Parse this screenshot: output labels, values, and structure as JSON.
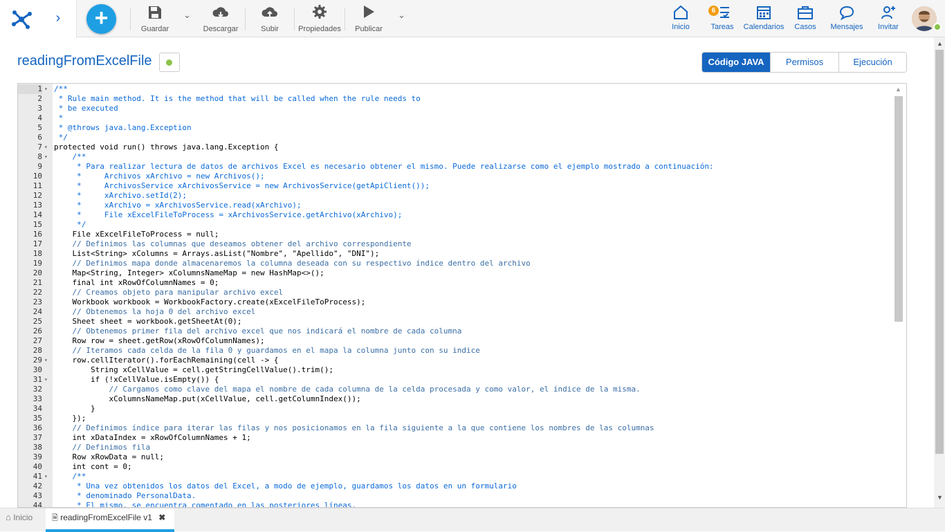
{
  "toolbar": {
    "save_label": "Guardar",
    "download_label": "Descargar",
    "upload_label": "Subir",
    "properties_label": "Propiedades",
    "publish_label": "Publicar"
  },
  "nav": {
    "home_label": "Inicio",
    "tasks_label": "Tareas",
    "tasks_badge": "6",
    "calendars_label": "Calendarios",
    "cases_label": "Casos",
    "messages_label": "Mensajes",
    "invite_label": "Invitar"
  },
  "header": {
    "title": "readingFromExcelFile",
    "tabs": [
      "Código JAVA",
      "Permisos",
      "Ejecución"
    ]
  },
  "editor": {
    "lines": [
      {
        "n": "1",
        "text": "/**",
        "fold": true,
        "cls": "cm"
      },
      {
        "n": "2",
        "text": " * Rule main method. It is the method that will be called when the rule needs to",
        "cls": "cm"
      },
      {
        "n": "3",
        "text": " * be executed",
        "cls": "cm"
      },
      {
        "n": "4",
        "text": " *",
        "cls": "cm"
      },
      {
        "n": "5",
        "text": " * @throws java.lang.Exception",
        "cls": "cm"
      },
      {
        "n": "6",
        "text": " */",
        "cls": "cm"
      },
      {
        "n": "7",
        "text": "protected void run() throws java.lang.Exception {",
        "fold": true,
        "cls": ""
      },
      {
        "n": "8",
        "text": "    /**",
        "fold": true,
        "cls": "cm"
      },
      {
        "n": "9",
        "text": "     * Para realizar lectura de datos de archivos Excel es necesario obtener el mismo. Puede realizarse como el ejemplo mostrado a continuación:",
        "cls": "cm"
      },
      {
        "n": "10",
        "text": "     *     Archivos xArchivo = new Archivos();",
        "cls": "cm"
      },
      {
        "n": "11",
        "text": "     *     ArchivosService xArchivosService = new ArchivosService(getApiClient());",
        "cls": "cm"
      },
      {
        "n": "12",
        "text": "     *     xArchivo.setId(2);",
        "cls": "cm"
      },
      {
        "n": "13",
        "text": "     *     xArchivo = xArchivosService.read(xArchivo);",
        "cls": "cm"
      },
      {
        "n": "14",
        "text": "     *     File xExcelFileToProcess = xArchivosService.getArchivo(xArchivo);",
        "cls": "cm"
      },
      {
        "n": "15",
        "text": "     */",
        "cls": "cm"
      },
      {
        "n": "16",
        "text": "    File xExcelFileToProcess = null;",
        "cls": ""
      },
      {
        "n": "17",
        "text": "    // Definimos las columnas que deseamos obtener del archivo correspondiente",
        "cls": "cm2"
      },
      {
        "n": "18",
        "text": "    List<String> xColumns = Arrays.asList(\"Nombre\", \"Apellido\", \"DNI\");",
        "cls": ""
      },
      {
        "n": "19",
        "text": "    // Definimos mapa donde almacenaremos la columna deseada con su respectivo índice dentro del archivo",
        "cls": "cm2"
      },
      {
        "n": "20",
        "text": "    Map<String, Integer> xColumnsNameMap = new HashMap<>();",
        "cls": ""
      },
      {
        "n": "21",
        "text": "    final int xRowOfColumnNames = 0;",
        "cls": ""
      },
      {
        "n": "22",
        "text": "    // Creamos objeto para manipular archivo excel",
        "cls": "cm2"
      },
      {
        "n": "23",
        "text": "    Workbook workbook = WorkbookFactory.create(xExcelFileToProcess);",
        "cls": ""
      },
      {
        "n": "24",
        "text": "    // Obtenemos la hoja 0 del archivo excel",
        "cls": "cm2"
      },
      {
        "n": "25",
        "text": "    Sheet sheet = workbook.getSheetAt(0);",
        "cls": ""
      },
      {
        "n": "26",
        "text": "    // Obtenemos primer fila del archivo excel que nos indicará el nombre de cada columna",
        "cls": "cm2"
      },
      {
        "n": "27",
        "text": "    Row row = sheet.getRow(xRowOfColumnNames);",
        "cls": ""
      },
      {
        "n": "28",
        "text": "    // Iteramos cada celda de la fila 0 y guardamos en el mapa la columna junto con su indice",
        "cls": "cm2"
      },
      {
        "n": "29",
        "text": "    row.cellIterator().forEachRemaining(cell -> {",
        "fold": true,
        "cls": ""
      },
      {
        "n": "30",
        "text": "        String xCellValue = cell.getStringCellValue().trim();",
        "cls": ""
      },
      {
        "n": "31",
        "text": "        if (!xCellValue.isEmpty()) {",
        "fold": true,
        "cls": ""
      },
      {
        "n": "32",
        "text": "            // Cargamos como clave del mapa el nombre de cada columna de la celda procesada y como valor, el índice de la misma.",
        "cls": "cm2"
      },
      {
        "n": "33",
        "text": "            xColumnsNameMap.put(xCellValue, cell.getColumnIndex());",
        "cls": ""
      },
      {
        "n": "34",
        "text": "        }",
        "cls": ""
      },
      {
        "n": "35",
        "text": "    });",
        "cls": ""
      },
      {
        "n": "36",
        "text": "    // Definimos índice para iterar las filas y nos posicionamos en la fila siguiente a la que contiene los nombres de las columnas",
        "cls": "cm2"
      },
      {
        "n": "37",
        "text": "    int xDataIndex = xRowOfColumnNames + 1;",
        "cls": ""
      },
      {
        "n": "38",
        "text": "    // Definimos fila",
        "cls": "cm2"
      },
      {
        "n": "39",
        "text": "    Row xRowData = null;",
        "cls": ""
      },
      {
        "n": "40",
        "text": "    int cont = 0;",
        "cls": ""
      },
      {
        "n": "41",
        "text": "    /**",
        "fold": true,
        "cls": "cm"
      },
      {
        "n": "42",
        "text": "     * Una vez obtenidos los datos del Excel, a modo de ejemplo, guardamos los datos en un formulario",
        "cls": "cm"
      },
      {
        "n": "43",
        "text": "     * denominado PersonalData.",
        "cls": "cm"
      },
      {
        "n": "44",
        "text": "     * El mismo, se encuentra comentado en las posteriores líneas.",
        "cls": "cm"
      }
    ]
  },
  "bottom": {
    "home_tab": "Inicio",
    "doc_tab": "readingFromExcelFile v1"
  },
  "colors": {
    "brand": "#1565c0",
    "accent": "#1e9fe3",
    "status_active": "#8bc34a",
    "badge": "#f39c12"
  }
}
